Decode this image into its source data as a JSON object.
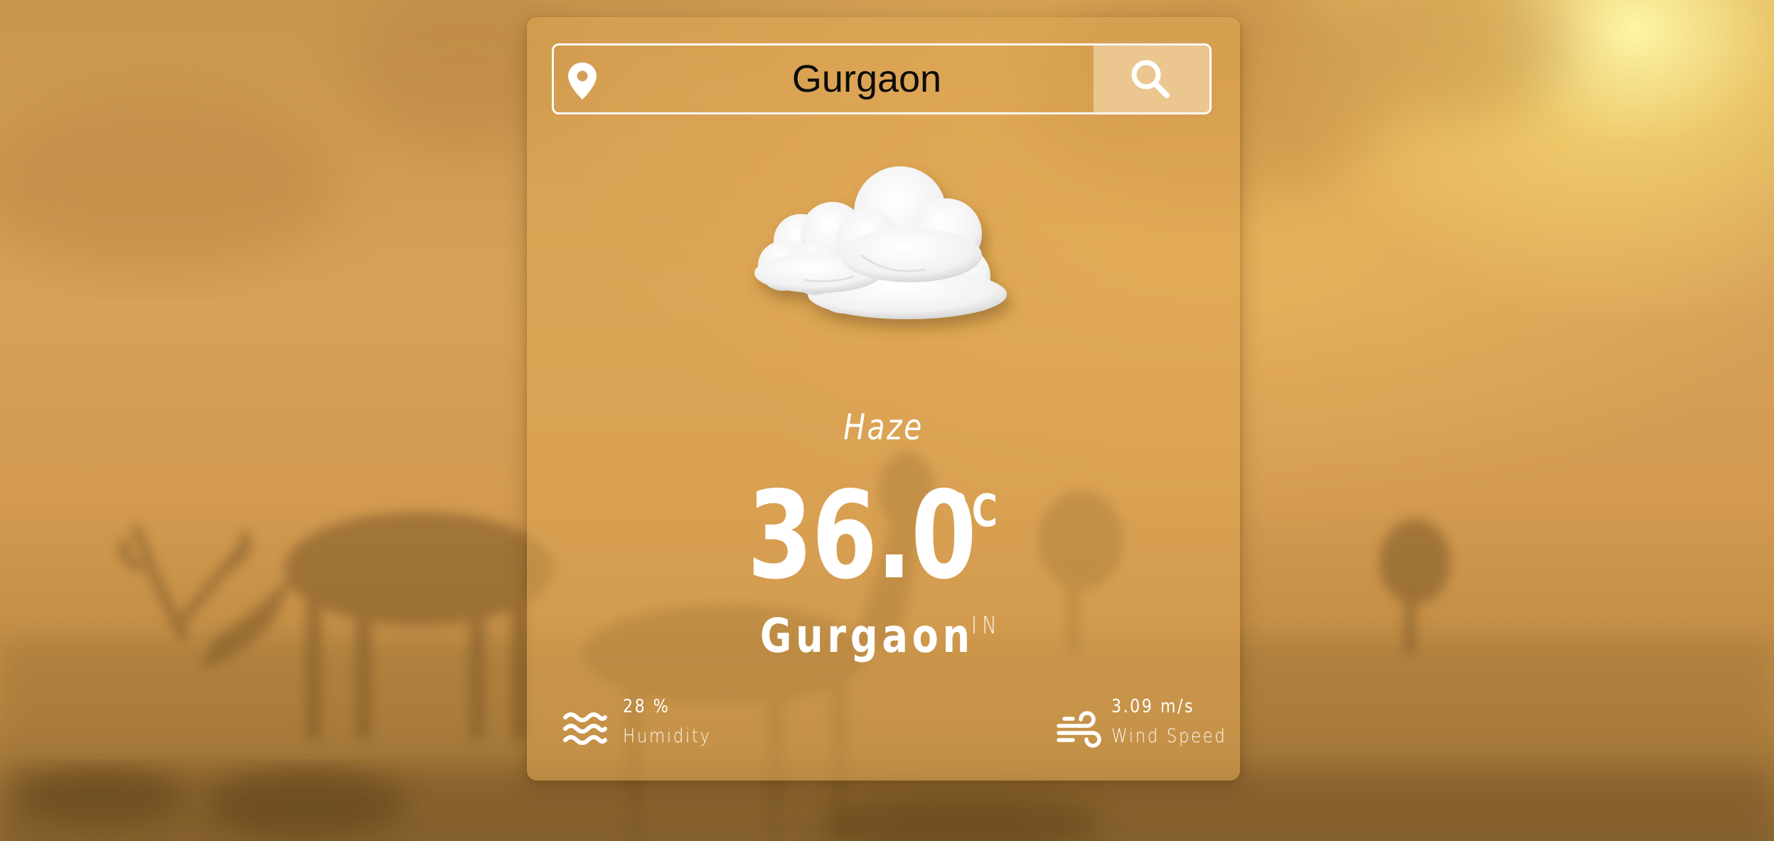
{
  "search": {
    "value": "Gurgaon",
    "location_icon": "map-pin-icon",
    "button_icon": "search-icon"
  },
  "weather": {
    "icon": "cloud-icon",
    "condition": "Haze",
    "temperature": "36.0",
    "unit": "°C",
    "city": "Gurgaon",
    "country": "IN"
  },
  "details": {
    "humidity": {
      "icon": "waves-icon",
      "value": "28 %",
      "label": "Humidity"
    },
    "wind": {
      "icon": "wind-icon",
      "value": "3.09 m/s",
      "label": "Wind Speed"
    }
  },
  "colors": {
    "card_tint": "#dea654",
    "text": "#ffffff",
    "input_text": "#0b0b0b",
    "background_glow": "#fdf3a0"
  }
}
